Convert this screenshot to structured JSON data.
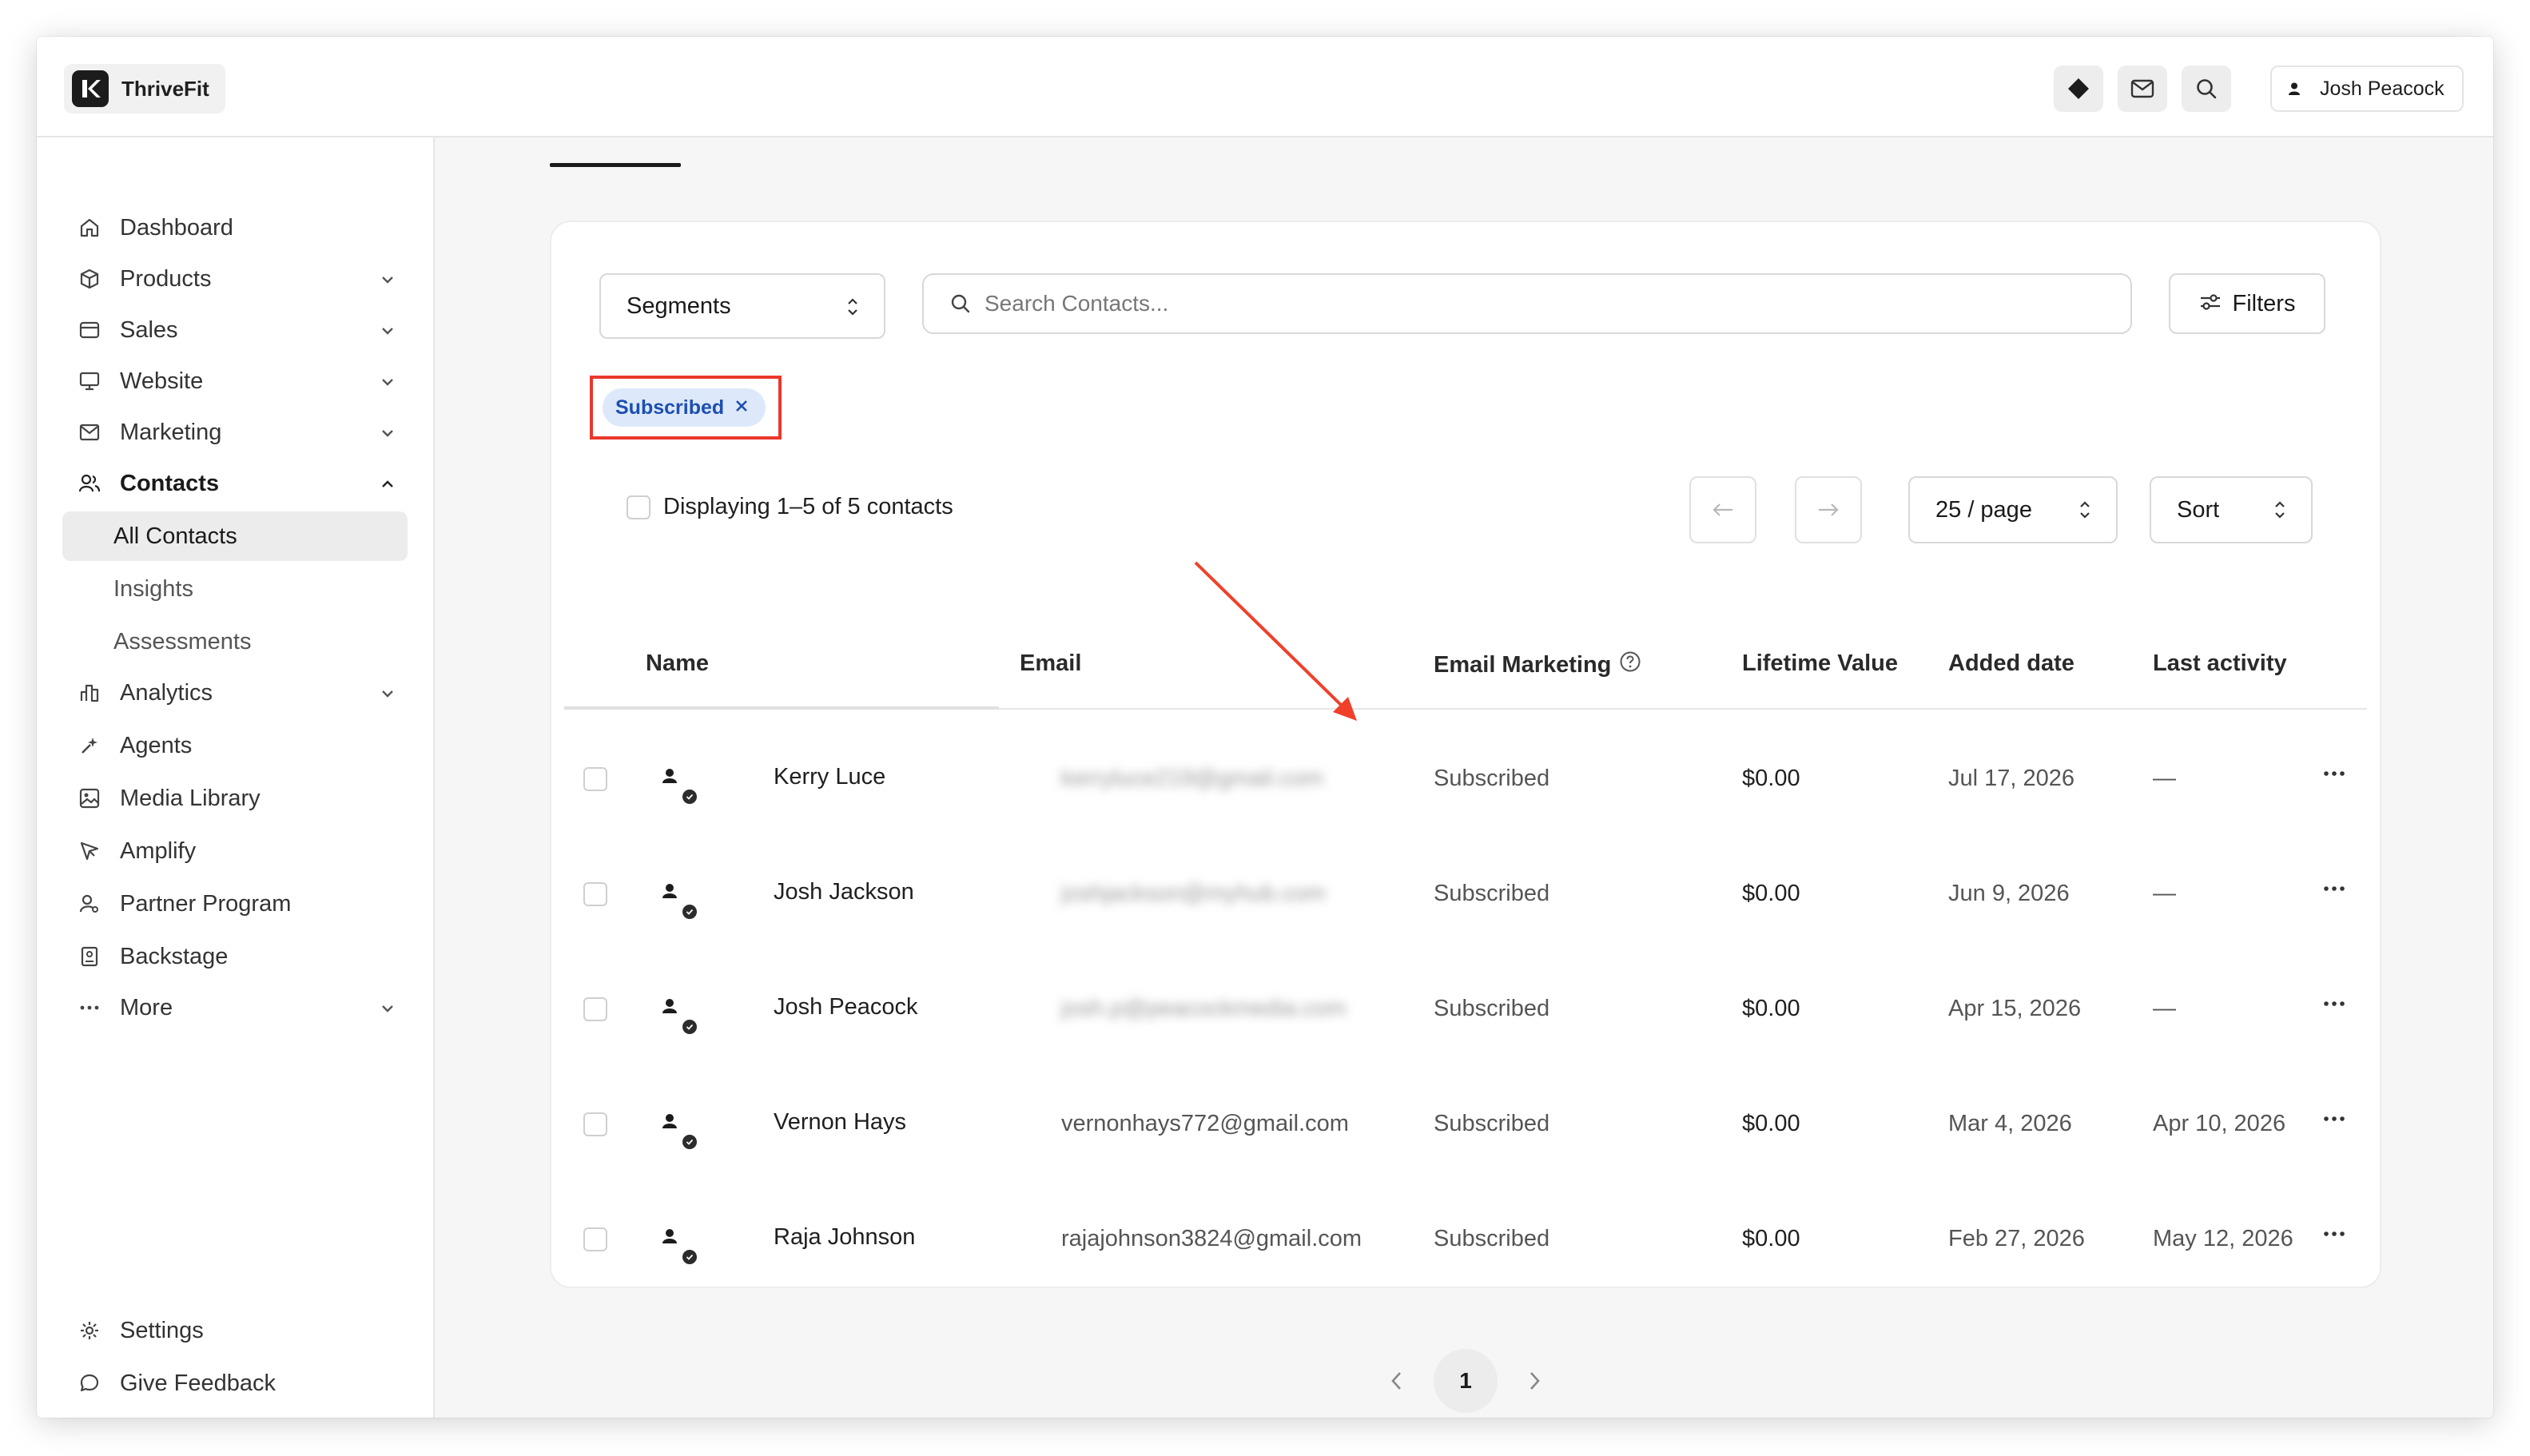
{
  "app": {
    "brand_name": "ThriveFit",
    "user_name": "Josh Peacock"
  },
  "topbar": {
    "icons": [
      "diamond-icon",
      "mail-icon",
      "search-icon",
      "user-icon"
    ]
  },
  "sidebar": {
    "items": [
      {
        "label": "Dashboard",
        "icon": "home-icon"
      },
      {
        "label": "Products",
        "icon": "box-icon",
        "chevron": "down"
      },
      {
        "label": "Sales",
        "icon": "card-icon",
        "chevron": "down"
      },
      {
        "label": "Website",
        "icon": "monitor-icon",
        "chevron": "down"
      },
      {
        "label": "Marketing",
        "icon": "mail-icon",
        "chevron": "down"
      },
      {
        "label": "Contacts",
        "icon": "users-icon",
        "chevron": "up"
      },
      {
        "label": "All Contacts"
      },
      {
        "label": "Insights"
      },
      {
        "label": "Assessments"
      },
      {
        "label": "Analytics",
        "icon": "chart-icon",
        "chevron": "down"
      },
      {
        "label": "Agents",
        "icon": "sparkle-icon"
      },
      {
        "label": "Media Library",
        "icon": "image-icon"
      },
      {
        "label": "Amplify",
        "icon": "send-icon"
      },
      {
        "label": "Partner Program",
        "icon": "partner-icon"
      },
      {
        "label": "Backstage",
        "icon": "badge-icon"
      },
      {
        "label": "More",
        "icon": "dots-icon",
        "chevron": "down"
      }
    ],
    "bottom": [
      {
        "label": "Settings",
        "icon": "gear-icon"
      },
      {
        "label": "Give Feedback",
        "icon": "chat-icon"
      }
    ]
  },
  "toolbar": {
    "segments_label": "Segments",
    "search_placeholder": "Search Contacts...",
    "filters_label": "Filters",
    "active_filter": "Subscribed"
  },
  "list": {
    "display_text": "Displaying 1–5 of 5 contacts",
    "per_page": "25 / page",
    "sort_label": "Sort"
  },
  "table": {
    "headers": [
      "Name",
      "Email",
      "Email Marketing",
      "Lifetime Value",
      "Added date",
      "Last activity"
    ],
    "rows": [
      {
        "name": "Kerry Luce",
        "email": "kerryluce219@gmail.com",
        "email_blurred": true,
        "marketing": "Subscribed",
        "ltv": "$0.00",
        "added": "Jul 17, 2026",
        "last": "—"
      },
      {
        "name": "Josh Jackson",
        "email": "joshjackson@myhub.com",
        "email_blurred": true,
        "marketing": "Subscribed",
        "ltv": "$0.00",
        "added": "Jun 9, 2026",
        "last": "—"
      },
      {
        "name": "Josh Peacock",
        "email": "josh.p@peacockmedia.com",
        "email_blurred": true,
        "marketing": "Subscribed",
        "ltv": "$0.00",
        "added": "Apr 15, 2026",
        "last": "—"
      },
      {
        "name": "Vernon Hays",
        "email": "vernonhays772@gmail.com",
        "email_blurred": false,
        "marketing": "Subscribed",
        "ltv": "$0.00",
        "added": "Mar 4, 2026",
        "last": "Apr 10, 2026"
      },
      {
        "name": "Raja Johnson",
        "email": "rajajohnson3824@gmail.com",
        "email_blurred": false,
        "marketing": "Subscribed",
        "ltv": "$0.00",
        "added": "Feb 27, 2026",
        "last": "May 12, 2026"
      }
    ]
  },
  "pagination": {
    "current_page": "1"
  },
  "colors": {
    "highlight": "#e9382c",
    "chip_bg": "#dde9fb",
    "chip_text": "#1d4fb0",
    "arrow": "#f0402a"
  }
}
